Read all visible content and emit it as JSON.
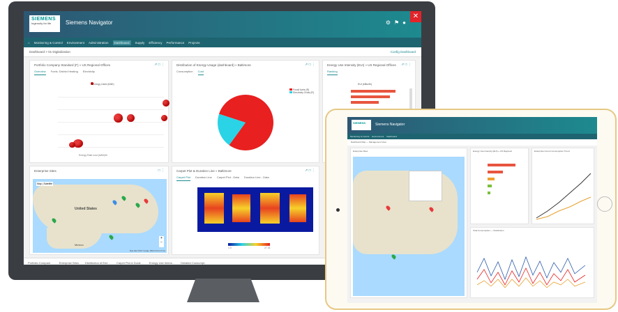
{
  "app": {
    "brand": "SIEMENS",
    "tagline": "Ingenuity for life",
    "title": "Siemens Navigator"
  },
  "header": {
    "icons": [
      "gear-icon",
      "bell-icon",
      "user-icon"
    ]
  },
  "menu": [
    "Monitoring & Control",
    "Environment",
    "Administration",
    "Dashboard",
    "Supply",
    "Efficiency",
    "Performance",
    "Projects"
  ],
  "breadcrumb": {
    "text": "Dashboard > 01 Digitalization",
    "config": "Config Dashboard"
  },
  "panels": {
    "p1": {
      "title": "Portfolio Company Standard (F) » US Regional Offices",
      "tabs": [
        "Overview",
        "Fuels: District Heating",
        "Electricity"
      ],
      "legend": "Energy Used (kWh)",
      "xlabel": "Energy Rate cost (kWh)/ft²"
    },
    "p2": {
      "title": "Distribution of Energy Usage (dashboard) » Baltimore",
      "tabs": [
        "Consumption",
        "Cost"
      ],
      "legend": [
        "Fossil fuels (R)",
        "Electricity Grids (R)"
      ]
    },
    "p3": {
      "title": "Energy Use Intensity (EUI) » US Regional Offices",
      "tabs": [
        "Ranking"
      ],
      "subtitle": "EUI (kBtu/ft²)"
    },
    "p4": {
      "title": "Enterprise Sites",
      "mapLabel": "United States",
      "mapLabel2": "Mexico",
      "mapCtrl": [
        "Map",
        "Satellite"
      ],
      "attr": "Map data ©2017 Google, INEGI  Terms of Use"
    },
    "p5": {
      "title": "Carpet Plot & Duration Line » Baltimore",
      "tabs": [
        "Carpet Plot",
        "Duration Line",
        "Carpet Plot - Data",
        "Duration Line - Data"
      ],
      "scale": [
        "1.0",
        "27.31"
      ]
    }
  },
  "chart_data": {
    "type": "pie",
    "values": [
      80,
      20
    ],
    "categories": [
      "Fossil fuels (R)",
      "Electricity Grids (R)"
    ],
    "colors": [
      "#e8201f",
      "#2ad3e6"
    ]
  },
  "taskbar": [
    "Portfolio Compare...",
    "Enterprise Sites",
    "Distribution of Ene...",
    "Carpet Plot & Durat...",
    "Energy Use Intens...",
    "Detailed Consumpt..."
  ],
  "tablet": {
    "title": "Siemens Navigator",
    "crumb": "Dashboard Map — Management View",
    "panels": [
      "Enterprise Sites",
      "Energy Use Intensity (EUI) » US Regional",
      "Enterprise Cost & Consumption Trend",
      "Total Consumption — Distribution"
    ]
  }
}
